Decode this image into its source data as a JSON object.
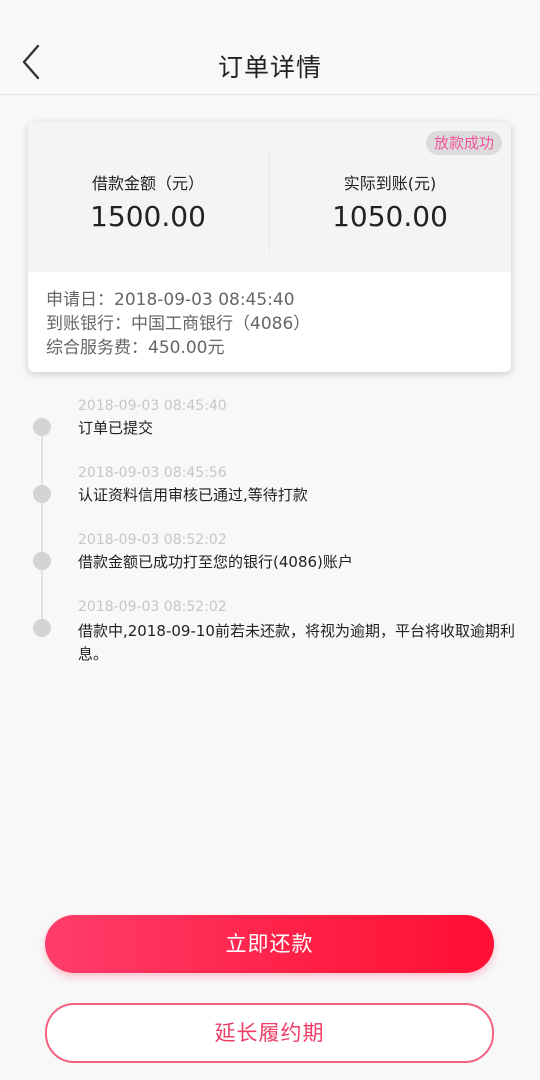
{
  "header": {
    "title": "订单详情",
    "back_icon": "chevron-left-icon"
  },
  "order": {
    "status": "放款成功",
    "loan_amount_label": "借款金额（元）",
    "loan_amount_value": "1500.00",
    "actual_received_label": "实际到账(元)",
    "actual_received_value": "1050.00",
    "apply_date": "申请日：2018-09-03 08:45:40",
    "bank": "到账银行：中国工商银行（4086）",
    "service_fee": "综合服务费：450.00元"
  },
  "timeline": [
    {
      "time": "2018-09-03 08:45:40",
      "text": "订单已提交"
    },
    {
      "time": "2018-09-03 08:45:56",
      "text": "认证资料信用审核已通过,等待打款"
    },
    {
      "time": "2018-09-03 08:52:02",
      "text": "借款金额已成功打至您的银行(4086)账户"
    },
    {
      "time": "2018-09-03 08:52:02",
      "text": "借款中,2018-09-10前若未还款，将视为逾期，平台将收取逾期利息。"
    }
  ],
  "actions": {
    "repay_label": "立即还款",
    "extend_label": "延长履约期"
  },
  "colors": {
    "accent": "#ff1f45",
    "status_text": "#f2559a",
    "secondary_border": "#f4607f"
  }
}
